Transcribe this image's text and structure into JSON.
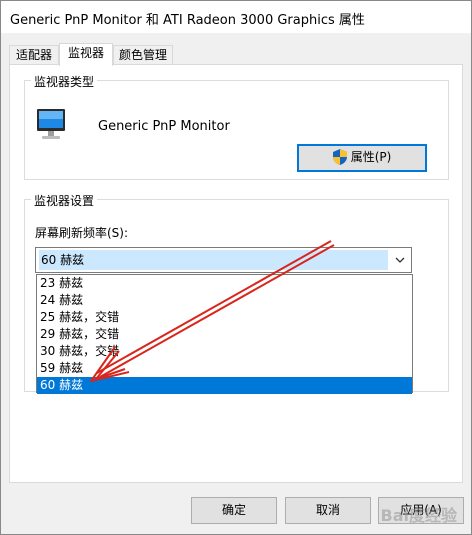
{
  "window": {
    "title": "Generic PnP Monitor 和 ATI Radeon 3000 Graphics 属性"
  },
  "tabs": [
    {
      "label": "适配器",
      "active": false
    },
    {
      "label": "监视器",
      "active": true
    },
    {
      "label": "颜色管理",
      "active": false
    }
  ],
  "monitor_type": {
    "group_title": "监视器类型",
    "monitor_name": "Generic PnP Monitor",
    "properties_button": "属性(P)"
  },
  "monitor_settings": {
    "group_title": "监视器设置",
    "refresh_label": "屏幕刷新频率(S):",
    "selected_value": "60 赫兹",
    "options": [
      {
        "label": "23 赫兹",
        "selected": false
      },
      {
        "label": "24 赫兹",
        "selected": false
      },
      {
        "label": "25 赫兹，交错",
        "selected": false
      },
      {
        "label": "29 赫兹，交错",
        "selected": false
      },
      {
        "label": "30 赫兹，交错",
        "selected": false
      },
      {
        "label": "59 赫兹",
        "selected": false
      },
      {
        "label": "60 赫兹",
        "selected": true
      }
    ]
  },
  "footer": {
    "ok": "确定",
    "cancel": "取消",
    "apply": "应用(A)"
  },
  "watermark": "Bai度经验",
  "colors": {
    "selection_blue": "#0078d7",
    "highlight_light": "#cce8ff",
    "annotation_arrow": "#d9261c"
  },
  "icons": [
    "monitor-icon",
    "shield-icon",
    "chevron-down-icon"
  ]
}
